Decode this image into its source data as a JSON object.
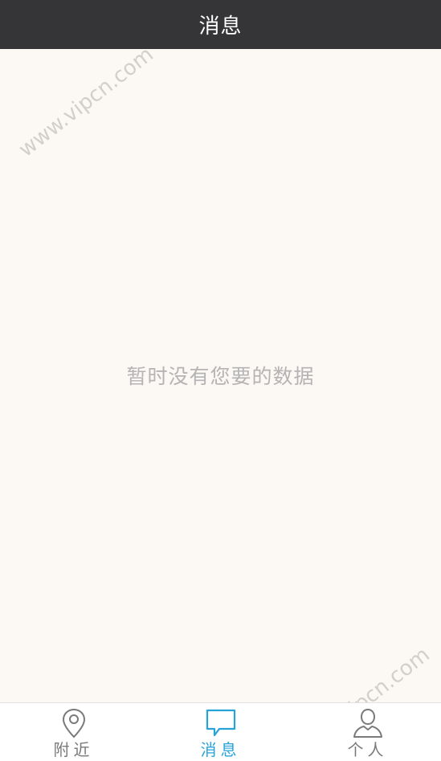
{
  "header": {
    "title": "消息"
  },
  "main": {
    "empty_message": "暂时没有您要的数据"
  },
  "watermark": {
    "text": "www.vipcn.com"
  },
  "tabbar": {
    "items": [
      {
        "label": "附近",
        "icon": "location-pin-icon",
        "active": false
      },
      {
        "label": "消息",
        "icon": "message-bubble-icon",
        "active": true
      },
      {
        "label": "个人",
        "icon": "person-icon",
        "active": false
      }
    ]
  },
  "colors": {
    "header_bg": "#353537",
    "content_bg": "#fcf8f3",
    "active_tab": "#27a3d8",
    "inactive_tab": "#7a7a7a"
  }
}
